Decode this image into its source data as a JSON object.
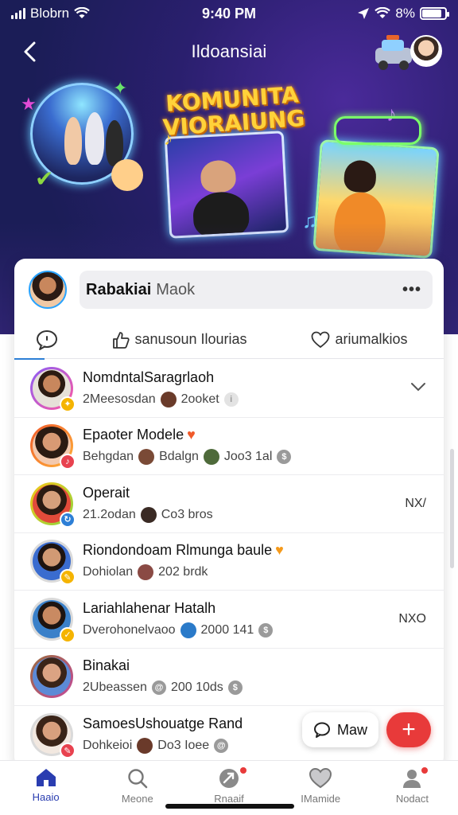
{
  "status_bar": {
    "carrier": "Blobrn",
    "time": "9:40 PM",
    "battery": "8%"
  },
  "header": {
    "title": "Ildoansiai"
  },
  "hero": {
    "title_line1": "KOMUNITA",
    "title_line2": "VIORAIUNG"
  },
  "composer": {
    "name_bold": "Rabakiai",
    "name_light": "Maok",
    "more_label": "•••"
  },
  "tabs": [
    {
      "label": ""
    },
    {
      "label": "sanusoun Ilourias"
    },
    {
      "label": "ariumalkios"
    }
  ],
  "rows": [
    {
      "name": "NomdntalSaragrlaoh",
      "sub_text": "2Meesosdan",
      "sub_meta": "2ooket",
      "right": "⌄",
      "ring_color": "#8a5cf6",
      "badge_color": "#f5b400"
    },
    {
      "name": "Epaoter Modele",
      "sub_text": "Behgdan",
      "sub_meta": "Bdalgn",
      "sub_meta2": "Joo3 1al",
      "right": "",
      "ring_color": "#f05a2a",
      "badge_color": "#e8424f"
    },
    {
      "name": "Operait",
      "sub_text": "21.2odan",
      "sub_meta": "Co3 bros",
      "right": "NX/",
      "ring_color": "#f5c518",
      "badge_color": "#2d7fd6"
    },
    {
      "name": "Riondondoam Rlmunga baule",
      "sub_text": "Dohiolan",
      "sub_meta": "202 brdk",
      "right": "",
      "ring_color": "#d9d9d9",
      "badge_color": "#f5b400"
    },
    {
      "name": "Lariahlahenar Hatalh",
      "sub_text": "Dverohonelvaoo",
      "sub_meta": "2000 141",
      "right": "NXO",
      "ring_color": "#d9d9d9",
      "badge_color": "#f5b400"
    },
    {
      "name": "Binakai",
      "sub_text": "2Ubeassen",
      "sub_meta": "200 10ds",
      "right": "",
      "ring_color": "#9b6b3c",
      "badge_color": "#f5b400"
    },
    {
      "name": "SamoesUshouatge Rand",
      "sub_text": "Dohkeioi",
      "sub_meta": "Do3 Ioee",
      "right": "",
      "ring_color": "#d9d9d9",
      "badge_color": "#e8424f"
    }
  ],
  "chat_button": {
    "label": "Maw"
  },
  "fab": {
    "label": "+"
  },
  "bottom_nav": [
    {
      "label": "Haaio",
      "icon": "home-icon",
      "active": true
    },
    {
      "label": "Meone",
      "icon": "search-icon",
      "active": false
    },
    {
      "label": "Rnaaif",
      "icon": "rocket-icon",
      "active": false
    },
    {
      "label": "IMamide",
      "icon": "heart-icon",
      "active": false
    },
    {
      "label": "Nodact",
      "icon": "profile-icon",
      "active": false
    }
  ],
  "colors": {
    "accent": "#2a3db0",
    "fab": "#e83a3a",
    "hero_bg": "#2a1f6e"
  }
}
